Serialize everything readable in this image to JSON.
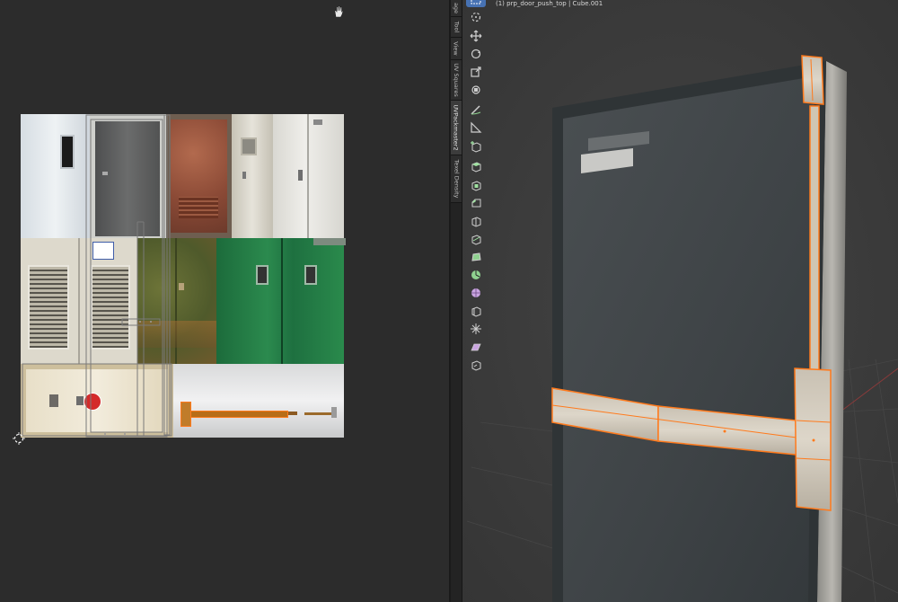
{
  "uv_editor": {
    "cursor_icon": "2d-cursor-icon",
    "hand_icon": "hand-pan-icon",
    "texture_tiles": [
      "white-door",
      "gray-door",
      "rusty-red-door",
      "beige-window-door",
      "white-double-door",
      "vented-double-door",
      "green-rusty-door",
      "green-double-door",
      "beige-panel-with-stop-sign",
      "push-bar-texture"
    ]
  },
  "sidebar": {
    "tabs": [
      {
        "label": "age"
      },
      {
        "label": "Tool"
      },
      {
        "label": "View"
      },
      {
        "label": "UV Squares"
      },
      {
        "label": "UVPackmaster2"
      },
      {
        "label": "Texel Density"
      }
    ],
    "active_tab": "UVPackmaster2"
  },
  "viewport": {
    "header_text": "(1) prp_door_push_top | Cube.001",
    "tools": [
      "select-box-icon",
      "cursor-icon",
      "move-icon",
      "rotate-icon",
      "scale-icon",
      "transform-icon",
      "annotate-icon",
      "measure-icon",
      "add-cube-icon",
      "extrude-region-icon",
      "inset-faces-icon",
      "bevel-icon",
      "loop-cut-icon",
      "knife-icon",
      "poly-build-icon",
      "spin-icon",
      "smooth-vertices-icon",
      "edge-slide-icon",
      "shrink-fatten-icon",
      "shear-icon",
      "rip-region-icon"
    ],
    "colors": {
      "selection": "#ff7a1c",
      "active_tool": "#4772b3",
      "axis_red": "#a03636"
    }
  }
}
